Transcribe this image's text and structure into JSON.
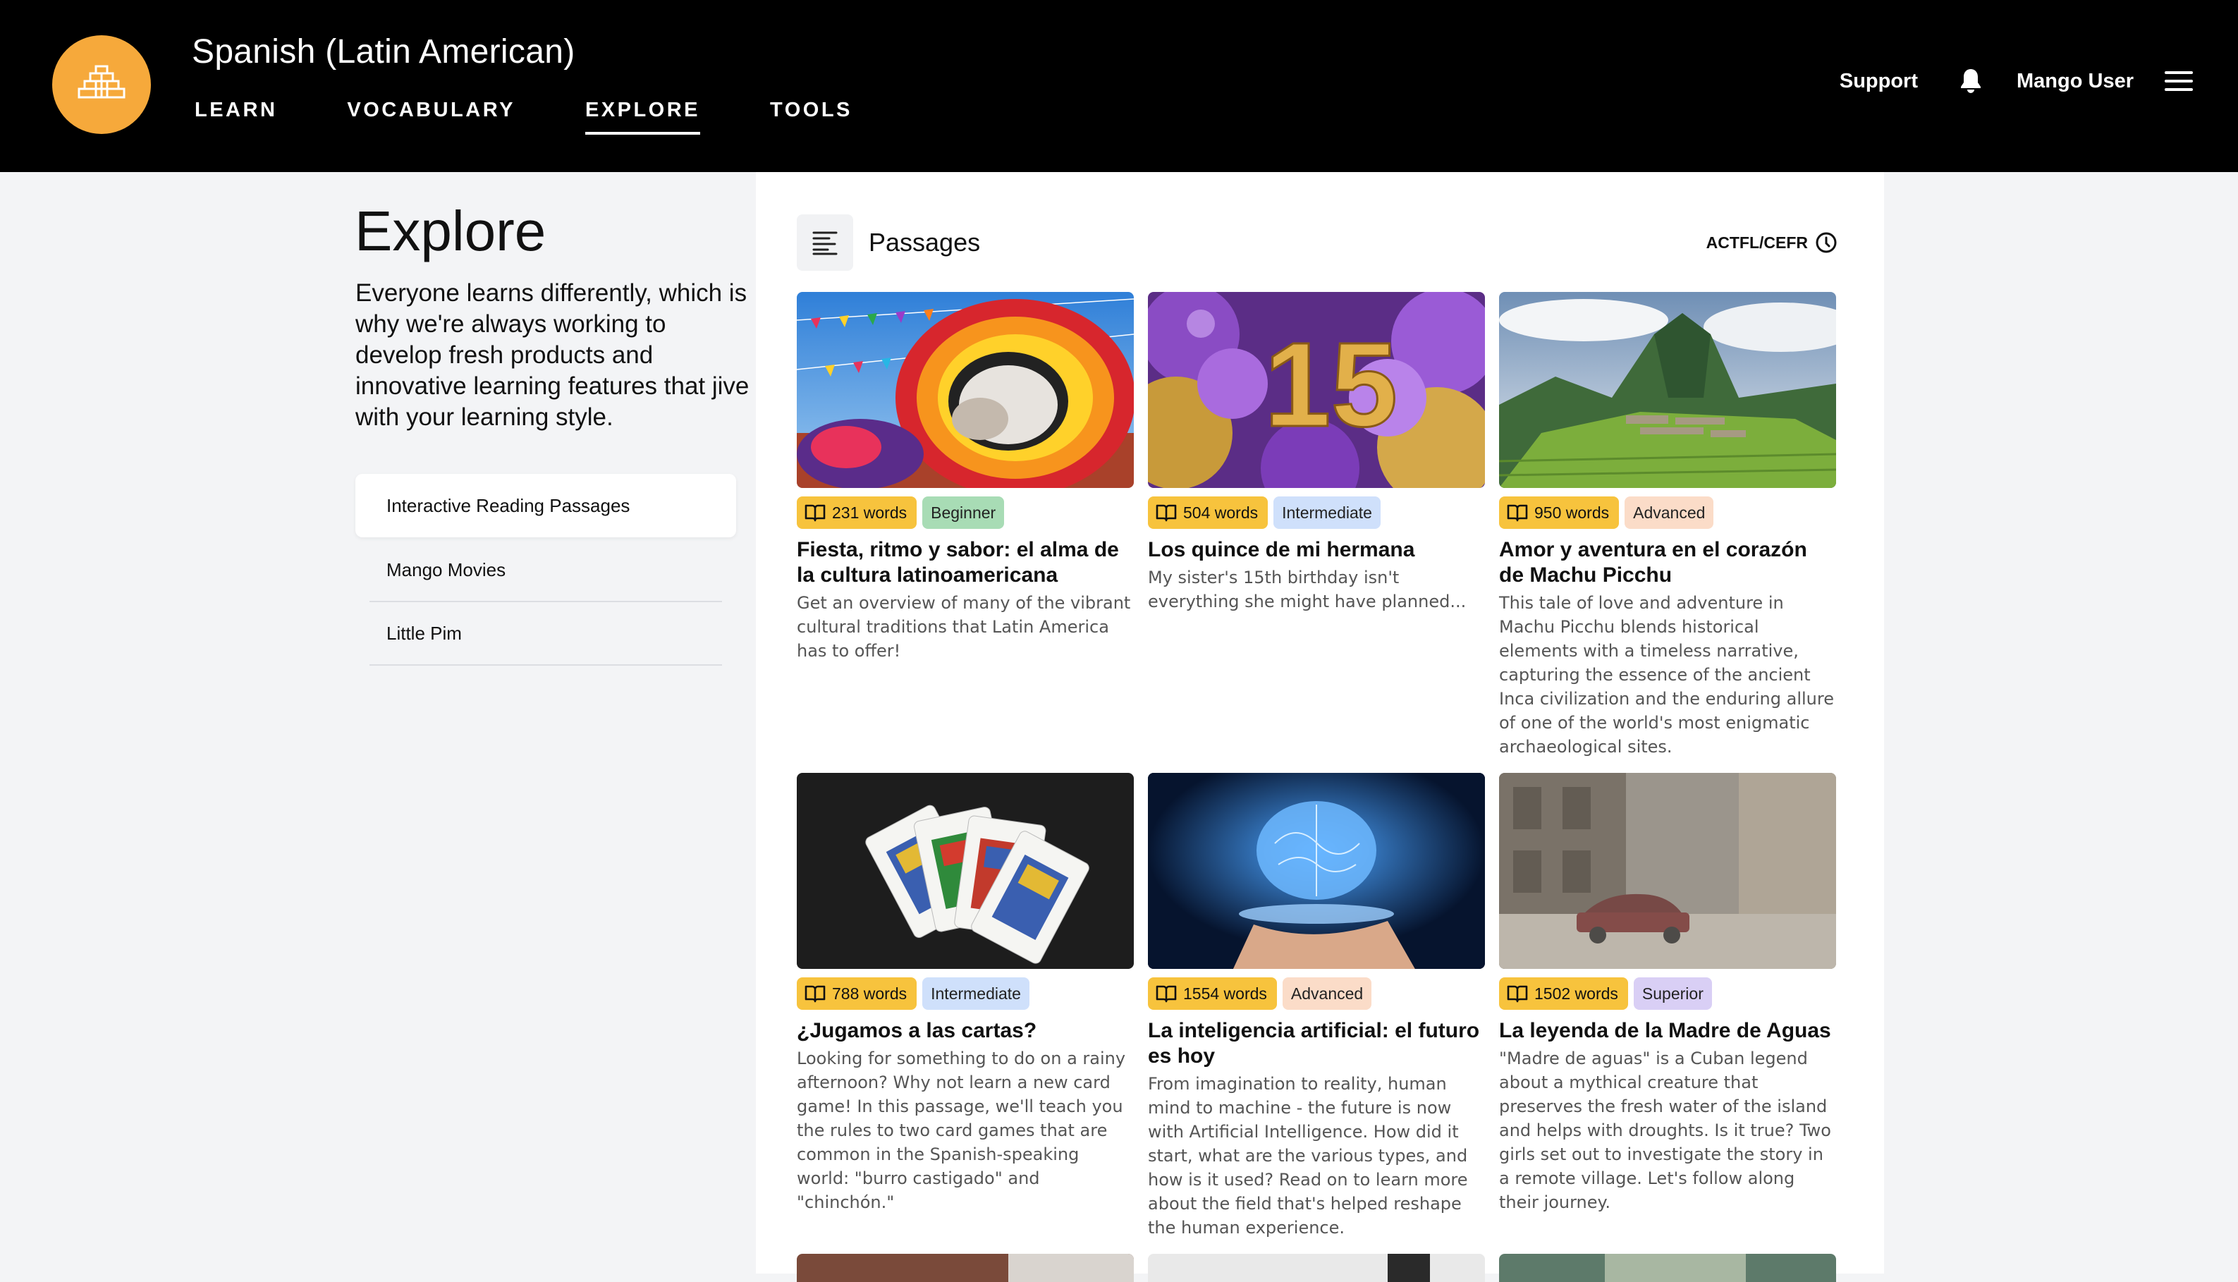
{
  "header": {
    "course_title": "Spanish (Latin American)",
    "nav": [
      {
        "label": "LEARN",
        "active": false
      },
      {
        "label": "VOCABULARY",
        "active": false
      },
      {
        "label": "EXPLORE",
        "active": true
      },
      {
        "label": "TOOLS",
        "active": false
      }
    ],
    "support_label": "Support",
    "user_name": "Mango User",
    "logo_icon": "pyramid-icon",
    "bell_icon": "bell-icon",
    "menu_icon": "hamburger-icon"
  },
  "sidebar": {
    "title": "Explore",
    "description": "Everyone learns differently, which is why we're always working to develop fresh products and innovative learning features that jive with your learning style.",
    "items": [
      {
        "label": "Interactive Reading Passages",
        "active": true
      },
      {
        "label": "Mango Movies",
        "active": false
      },
      {
        "label": "Little Pim",
        "active": false
      }
    ]
  },
  "main": {
    "section_title": "Passages",
    "section_icon": "text-align-left-icon",
    "actfl_label": "ACTFL/CEFR",
    "actfl_icon": "info-icon",
    "cards": [
      {
        "words": "231 words",
        "level": "Beginner",
        "level_color": "#a8dcb5",
        "title": "Fiesta, ritmo y sabor: el alma de la cultura latinoamericana",
        "desc": "Get an overview of many of the vibrant cultural traditions that Latin America has to offer!"
      },
      {
        "words": "504 words",
        "level": "Intermediate",
        "level_color": "#cfe0fb",
        "title": "Los quince de mi hermana",
        "desc": "My sister's 15th birthday isn't everything she might have planned..."
      },
      {
        "words": "950 words",
        "level": "Advanced",
        "level_color": "#fbdcc8",
        "title": "Amor y aventura en el corazón de Machu Picchu",
        "desc": "This tale of love and adventure in Machu Picchu blends historical elements with a timeless narrative, capturing the essence of the ancient Inca civilization and the enduring allure of one of the world's most enigmatic archaeological sites."
      },
      {
        "words": "788 words",
        "level": "Intermediate",
        "level_color": "#cfe0fb",
        "title": "¿Jugamos a las cartas?",
        "desc": "Looking for something to do on a rainy afternoon? Why not learn a new card game! In this passage, we'll teach you the rules to two card games that are common in the Spanish-speaking world: \"burro castigado\" and \"chinchón.\""
      },
      {
        "words": "1554 words",
        "level": "Advanced",
        "level_color": "#fbdcc8",
        "title": "La inteligencia artificial: el futuro es hoy",
        "desc": "From imagination to reality, human mind to machine - the future is now with Artificial Intelligence. How did it start, what are the various types, and how is it used? Read on to learn more about the field that's helped reshape the human experience."
      },
      {
        "words": "1502 words",
        "level": "Superior",
        "level_color": "#d9cff5",
        "title": "La leyenda de la Madre de Aguas",
        "desc": "\"Madre de aguas\" is a Cuban legend about a mythical creature that preserves the fresh water of the island and helps with droughts. Is it true? Two girls set out to investigate the story in a remote village. Let's follow along their journey."
      }
    ]
  },
  "colors": {
    "header_bg": "#000000",
    "logo_bg": "#f6a93b",
    "words_badge": "#f7c33d",
    "page_bg": "#f3f4f6"
  }
}
